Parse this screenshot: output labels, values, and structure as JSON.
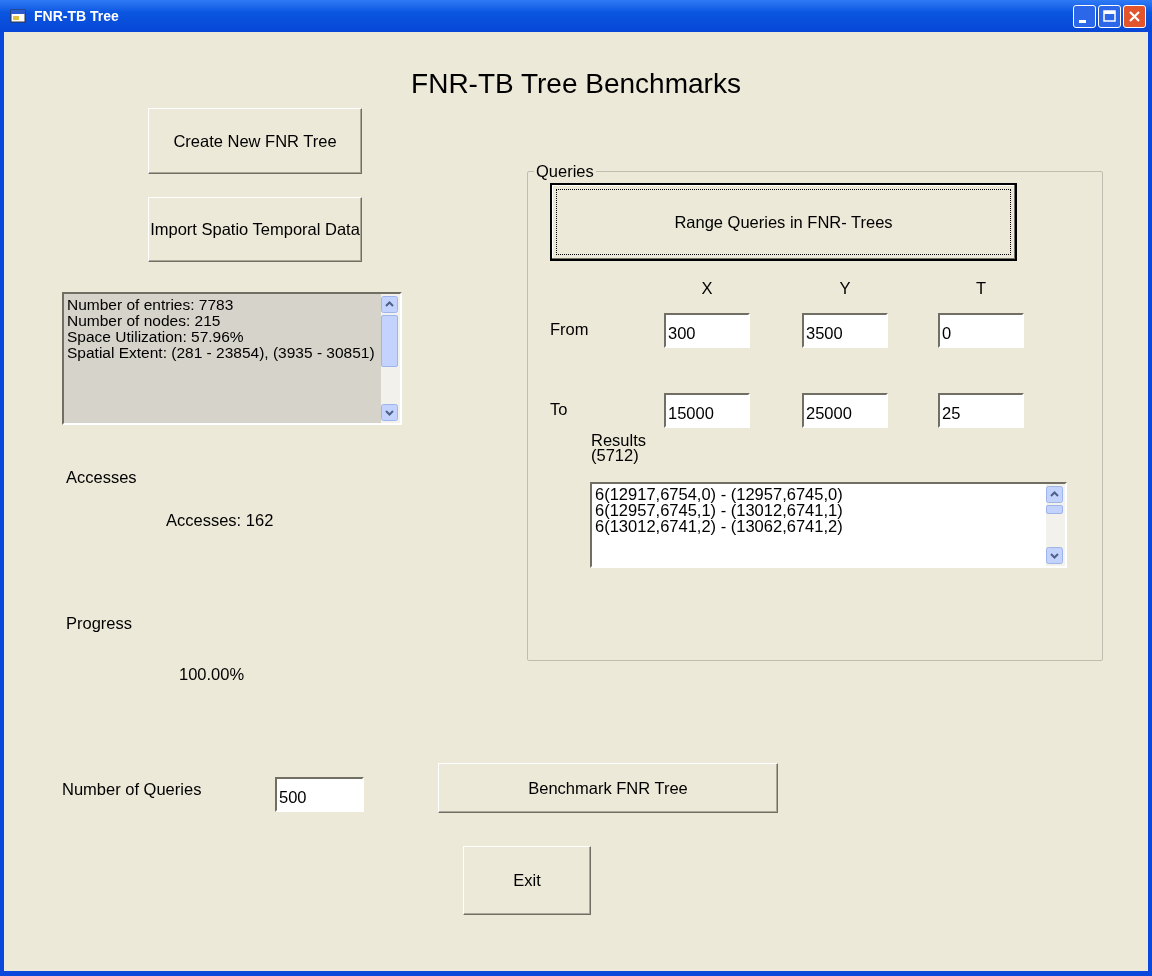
{
  "window": {
    "title": "FNR-TB Tree"
  },
  "heading": "FNR-TB Tree Benchmarks",
  "left": {
    "create_button": "Create New FNR Tree",
    "import_button": "Import Spatio Temporal Data",
    "stats": [
      "Number of entries: 7783",
      "Number of nodes: 215",
      "Space Utilization: 57.96%",
      "Spatial Extent: (281 - 23854), (3935 - 30851)"
    ],
    "accesses_label": "Accesses",
    "accesses_value": "Accesses: 162",
    "progress_label": "Progress",
    "progress_value": "100.00%"
  },
  "queries": {
    "legend": "Queries",
    "range_button": {
      "label": "Range Queries in FNR- Trees",
      "focused": true
    },
    "columns": [
      "X",
      "Y",
      "T"
    ],
    "rows": [
      {
        "label": "From",
        "values": [
          "300",
          "3500",
          "0"
        ]
      },
      {
        "label": "To",
        "values": [
          "15000",
          "25000",
          "25"
        ]
      }
    ],
    "results_label": "Results",
    "results_count": "(5712)",
    "results": [
      "6(12917,6754,0) - (12957,6745,0)",
      "6(12957,6745,1) - (13012,6741,1)",
      "6(13012,6741,2) - (13062,6741,2)"
    ]
  },
  "bottom": {
    "queries_label": "Number of Queries",
    "queries_value": "500",
    "benchmark_button": "Benchmark FNR Tree",
    "exit_button": "Exit"
  }
}
